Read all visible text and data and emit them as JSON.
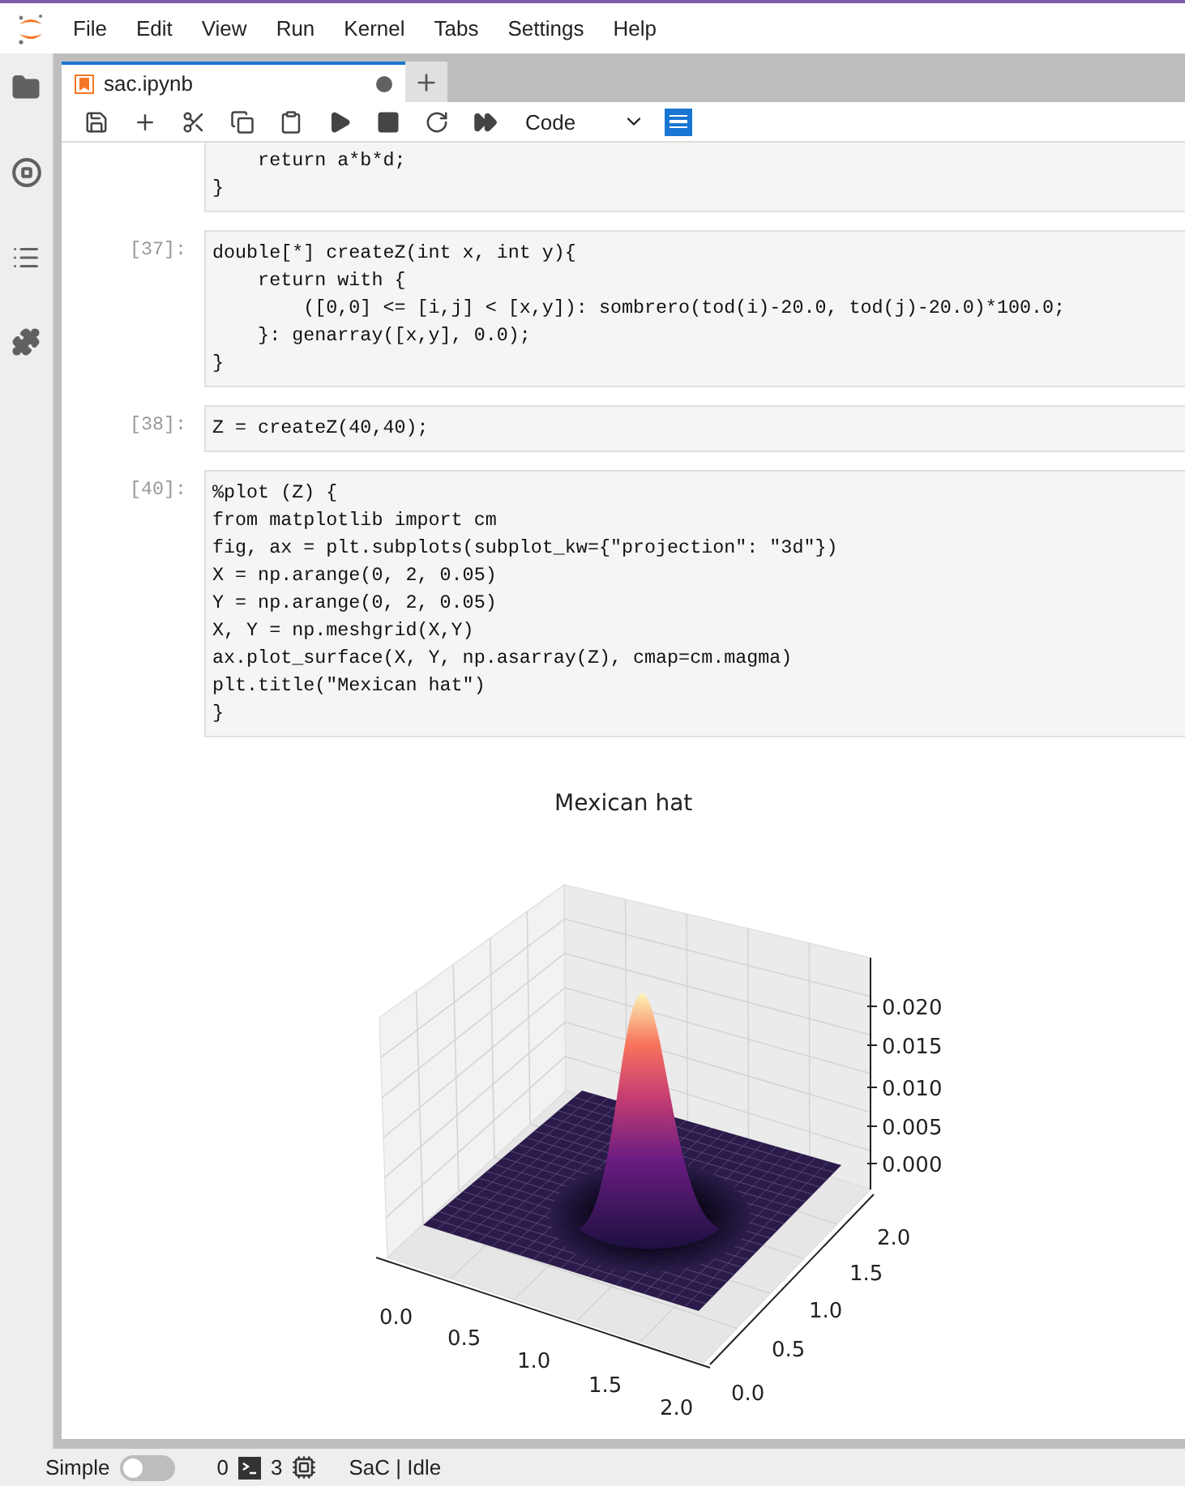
{
  "menu": [
    "File",
    "Edit",
    "View",
    "Run",
    "Kernel",
    "Tabs",
    "Settings",
    "Help"
  ],
  "tabs": [
    {
      "label": "sac.ipynb",
      "selected": true,
      "modified": true
    }
  ],
  "toolbar": {
    "cell_type": "Code"
  },
  "cells": [
    {
      "code": "    return a*b*d;\n}"
    },
    {
      "prompt": "[37]:",
      "code": "double[*] createZ(int x, int y){\n    return with {\n        ([0,0] <= [i,j] < [x,y]): sombrero(tod(i)-20.0, tod(j)-20.0)*100.0;\n    }: genarray([x,y], 0.0);\n}"
    },
    {
      "prompt": "[38]:",
      "code": "Z = createZ(40,40);"
    },
    {
      "prompt": "[40]:",
      "code": "%plot (Z) {\nfrom matplotlib import cm\nfig, ax = plt.subplots(subplot_kw={\"projection\": \"3d\"})\nX = np.arange(0, 2, 0.05)\nY = np.arange(0, 2, 0.05)\nX, Y = np.meshgrid(X,Y)\nax.plot_surface(X, Y, np.asarray(Z), cmap=cm.magma)\nplt.title(\"Mexican hat\")\n}"
    }
  ],
  "plot": {
    "title": "Mexican hat",
    "z_ticks": [
      "0.020",
      "0.015",
      "0.010",
      "0.005",
      "0.000"
    ],
    "y_ticks": [
      "2.0",
      "1.5",
      "1.0",
      "0.5",
      "0.0"
    ],
    "x_ticks": [
      "0.0",
      "0.5",
      "1.0",
      "1.5",
      "2.0"
    ]
  },
  "status_bar": {
    "mode_label": "Simple",
    "simple_on": false,
    "terminals": "0",
    "kernels": "3",
    "kernel_status": "SaC | Idle"
  }
}
